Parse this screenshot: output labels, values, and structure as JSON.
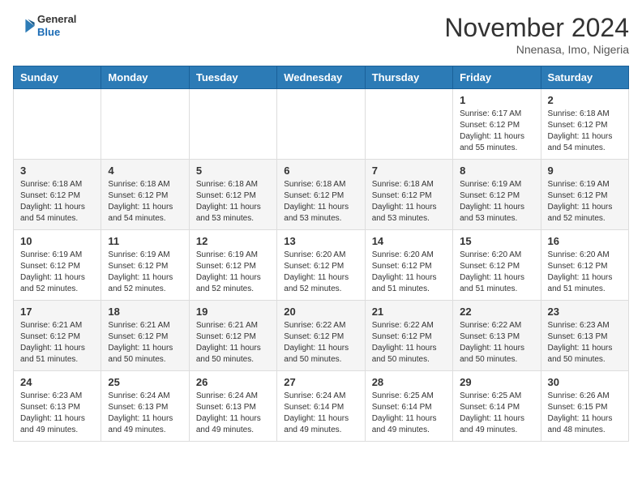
{
  "header": {
    "logo_line1": "General",
    "logo_line2": "Blue",
    "month": "November 2024",
    "location": "Nnenasa, Imo, Nigeria"
  },
  "weekdays": [
    "Sunday",
    "Monday",
    "Tuesday",
    "Wednesday",
    "Thursday",
    "Friday",
    "Saturday"
  ],
  "weeks": [
    [
      null,
      null,
      null,
      null,
      null,
      {
        "day": "1",
        "sunrise": "6:17 AM",
        "sunset": "6:12 PM",
        "daylight": "11 hours and 55 minutes."
      },
      {
        "day": "2",
        "sunrise": "6:18 AM",
        "sunset": "6:12 PM",
        "daylight": "11 hours and 54 minutes."
      }
    ],
    [
      {
        "day": "3",
        "sunrise": "6:18 AM",
        "sunset": "6:12 PM",
        "daylight": "11 hours and 54 minutes."
      },
      {
        "day": "4",
        "sunrise": "6:18 AM",
        "sunset": "6:12 PM",
        "daylight": "11 hours and 54 minutes."
      },
      {
        "day": "5",
        "sunrise": "6:18 AM",
        "sunset": "6:12 PM",
        "daylight": "11 hours and 53 minutes."
      },
      {
        "day": "6",
        "sunrise": "6:18 AM",
        "sunset": "6:12 PM",
        "daylight": "11 hours and 53 minutes."
      },
      {
        "day": "7",
        "sunrise": "6:18 AM",
        "sunset": "6:12 PM",
        "daylight": "11 hours and 53 minutes."
      },
      {
        "day": "8",
        "sunrise": "6:19 AM",
        "sunset": "6:12 PM",
        "daylight": "11 hours and 53 minutes."
      },
      {
        "day": "9",
        "sunrise": "6:19 AM",
        "sunset": "6:12 PM",
        "daylight": "11 hours and 52 minutes."
      }
    ],
    [
      {
        "day": "10",
        "sunrise": "6:19 AM",
        "sunset": "6:12 PM",
        "daylight": "11 hours and 52 minutes."
      },
      {
        "day": "11",
        "sunrise": "6:19 AM",
        "sunset": "6:12 PM",
        "daylight": "11 hours and 52 minutes."
      },
      {
        "day": "12",
        "sunrise": "6:19 AM",
        "sunset": "6:12 PM",
        "daylight": "11 hours and 52 minutes."
      },
      {
        "day": "13",
        "sunrise": "6:20 AM",
        "sunset": "6:12 PM",
        "daylight": "11 hours and 52 minutes."
      },
      {
        "day": "14",
        "sunrise": "6:20 AM",
        "sunset": "6:12 PM",
        "daylight": "11 hours and 51 minutes."
      },
      {
        "day": "15",
        "sunrise": "6:20 AM",
        "sunset": "6:12 PM",
        "daylight": "11 hours and 51 minutes."
      },
      {
        "day": "16",
        "sunrise": "6:20 AM",
        "sunset": "6:12 PM",
        "daylight": "11 hours and 51 minutes."
      }
    ],
    [
      {
        "day": "17",
        "sunrise": "6:21 AM",
        "sunset": "6:12 PM",
        "daylight": "11 hours and 51 minutes."
      },
      {
        "day": "18",
        "sunrise": "6:21 AM",
        "sunset": "6:12 PM",
        "daylight": "11 hours and 50 minutes."
      },
      {
        "day": "19",
        "sunrise": "6:21 AM",
        "sunset": "6:12 PM",
        "daylight": "11 hours and 50 minutes."
      },
      {
        "day": "20",
        "sunrise": "6:22 AM",
        "sunset": "6:12 PM",
        "daylight": "11 hours and 50 minutes."
      },
      {
        "day": "21",
        "sunrise": "6:22 AM",
        "sunset": "6:12 PM",
        "daylight": "11 hours and 50 minutes."
      },
      {
        "day": "22",
        "sunrise": "6:22 AM",
        "sunset": "6:13 PM",
        "daylight": "11 hours and 50 minutes."
      },
      {
        "day": "23",
        "sunrise": "6:23 AM",
        "sunset": "6:13 PM",
        "daylight": "11 hours and 50 minutes."
      }
    ],
    [
      {
        "day": "24",
        "sunrise": "6:23 AM",
        "sunset": "6:13 PM",
        "daylight": "11 hours and 49 minutes."
      },
      {
        "day": "25",
        "sunrise": "6:24 AM",
        "sunset": "6:13 PM",
        "daylight": "11 hours and 49 minutes."
      },
      {
        "day": "26",
        "sunrise": "6:24 AM",
        "sunset": "6:13 PM",
        "daylight": "11 hours and 49 minutes."
      },
      {
        "day": "27",
        "sunrise": "6:24 AM",
        "sunset": "6:14 PM",
        "daylight": "11 hours and 49 minutes."
      },
      {
        "day": "28",
        "sunrise": "6:25 AM",
        "sunset": "6:14 PM",
        "daylight": "11 hours and 49 minutes."
      },
      {
        "day": "29",
        "sunrise": "6:25 AM",
        "sunset": "6:14 PM",
        "daylight": "11 hours and 49 minutes."
      },
      {
        "day": "30",
        "sunrise": "6:26 AM",
        "sunset": "6:15 PM",
        "daylight": "11 hours and 48 minutes."
      }
    ]
  ]
}
